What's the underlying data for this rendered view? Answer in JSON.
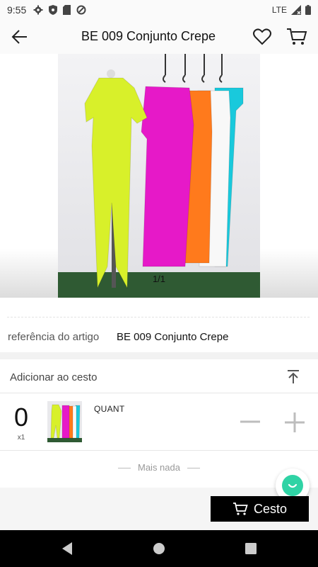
{
  "status_bar": {
    "time": "9:55",
    "network": "LTE",
    "icons": [
      "gear-icon",
      "shield-icon",
      "sd-card-icon",
      "sync-icon",
      "signal-icon",
      "battery-icon"
    ]
  },
  "header": {
    "title": "BE 009 Conjunto Crepe",
    "icons": [
      "back-arrow-icon",
      "heart-icon",
      "cart-icon"
    ]
  },
  "gallery": {
    "counter": "1/1",
    "garments": [
      {
        "color": "#d8f02a"
      },
      {
        "color": "#e619c8"
      },
      {
        "color": "#ff7a1c"
      },
      {
        "color": "#f8f8f8"
      },
      {
        "color": "#19c9dc"
      }
    ]
  },
  "reference": {
    "label": "referência do artigo",
    "value": "BE 009 Conjunto Crepe"
  },
  "basket": {
    "title": "Adicionar ao cesto",
    "item": {
      "quantity": "0",
      "multiplier": "x1",
      "qty_label": "QUANT"
    }
  },
  "footer": {
    "nothing_more": "Mais nada",
    "cart_button": "Cesto"
  },
  "colors": {
    "accent_chat": "#2fd3a5",
    "button_bg": "#000000"
  }
}
